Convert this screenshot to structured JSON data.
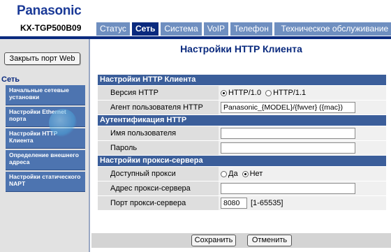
{
  "header": {
    "logo": "Panasonic",
    "model": "KX-TGP500B09",
    "tabs": [
      "Статус",
      "Сеть",
      "Система",
      "VoIP",
      "Телефон",
      "Техническое обслуживание"
    ],
    "active_tab": "Сеть"
  },
  "sidebar": {
    "close_port_button": "Закрыть порт Web",
    "heading": "Сеть",
    "items": [
      "Начальные сетевые установки",
      "Настройки Ethernet порта",
      "Настройки HTTP Клиента",
      "Определение внешнего адреса",
      "Настройки статического NAPT"
    ]
  },
  "main": {
    "title": "Настройки HTTP Клиента",
    "sections": {
      "http_client": {
        "heading": "Настройки HTTP Клиента",
        "version_label": "Версия HTTP",
        "version_options": [
          "HTTP/1.0",
          "HTTP/1.1"
        ],
        "version_selected": "HTTP/1.0",
        "agent_label": "Агент пользователя HTTP",
        "agent_value": "Panasonic_{MODEL}/{fwver} ({mac})"
      },
      "auth": {
        "heading": "Аутентификация HTTP",
        "username_label": "Имя пользователя",
        "username_value": "",
        "password_label": "Пароль",
        "password_value": ""
      },
      "proxy": {
        "heading": "Настройки прокси-сервера",
        "enabled_label": "Доступный прокси",
        "enabled_options": [
          "Да",
          "Нет"
        ],
        "enabled_selected": "Нет",
        "address_label": "Адрес прокси-сервера",
        "address_value": "",
        "port_label": "Порт прокси-сервера",
        "port_value": "8080",
        "port_range": "[1-65535]"
      }
    },
    "buttons": {
      "save": "Сохранить",
      "cancel": "Отменить"
    }
  },
  "colors": {
    "brand": "#1b3a97",
    "dark_blue": "#0a2a7e",
    "section": "#3b5e9a",
    "tab": "#6f8fc0"
  }
}
